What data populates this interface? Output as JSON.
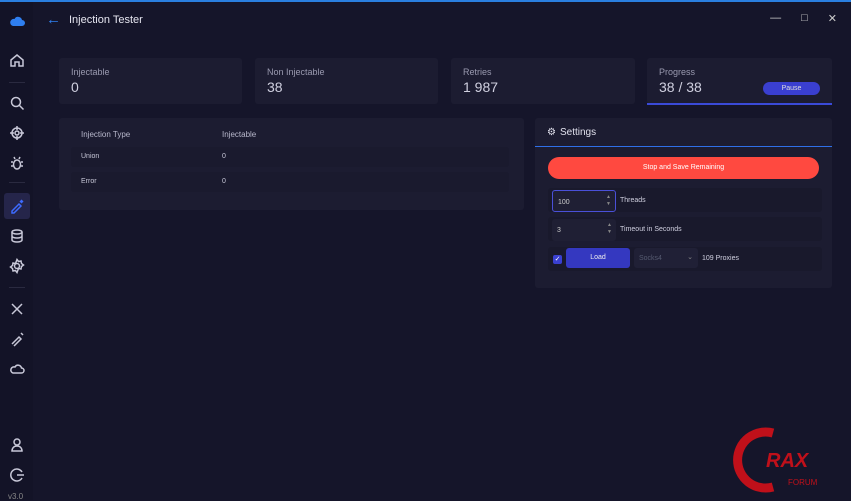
{
  "window": {
    "title": "Injection Tester",
    "back_icon": "arrow-left-icon",
    "controls": [
      "minimize",
      "maximize",
      "close"
    ]
  },
  "sidebar": {
    "version": "v3.0",
    "items": [
      "home",
      "search",
      "target",
      "bug",
      "injection",
      "database",
      "settings-gear",
      "tools",
      "syringe",
      "cloud",
      "user",
      "logout"
    ],
    "active": "injection"
  },
  "stats": [
    {
      "label": "Injectable",
      "value": "0"
    },
    {
      "label": "Non Injectable",
      "value": "38"
    },
    {
      "label": "Retries",
      "value": "1 987"
    },
    {
      "label": "Progress",
      "value": "38 / 38",
      "progress_fraction": 1.0,
      "button": "Pause"
    }
  ],
  "table": {
    "headers": [
      "Injection Type",
      "Injectable"
    ],
    "rows": [
      [
        "Union",
        "0"
      ],
      [
        "Error",
        "0"
      ]
    ]
  },
  "settings": {
    "title": "Settings",
    "stop_button": "Stop and Save Remaining",
    "threads": {
      "value": "100",
      "label": "Threads"
    },
    "timeout": {
      "value": "3",
      "label": "Timeout in Seconds"
    },
    "proxy": {
      "checked": true,
      "load_button": "Load",
      "type": "Socks4",
      "count_label": "109 Proxies"
    }
  },
  "watermark": {
    "text": "CRAX",
    "sub": "FORUM"
  },
  "colors": {
    "accent": "#3a40d0",
    "danger": "#ff4940",
    "background": "#15152a"
  }
}
